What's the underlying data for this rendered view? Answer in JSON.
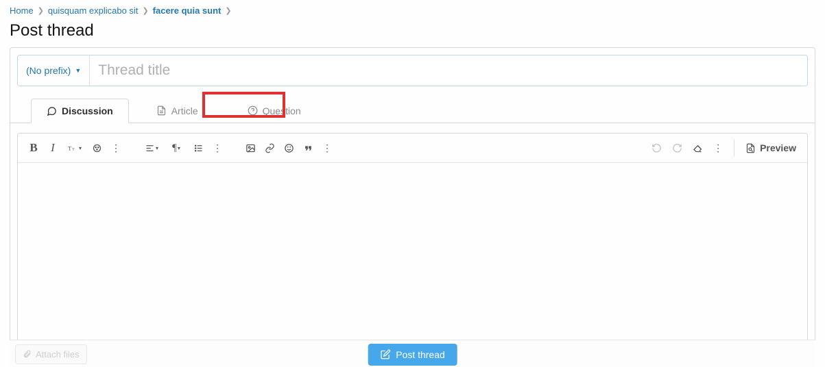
{
  "breadcrumb": {
    "home": "Home",
    "level1": "quisquam explicabo sit",
    "level2": "facere quia sunt"
  },
  "page_title": "Post thread",
  "prefix": {
    "label": "(No prefix)"
  },
  "title_field": {
    "placeholder": "Thread title"
  },
  "tabs": {
    "discussion": "Discussion",
    "article": "Article",
    "question": "Question"
  },
  "toolbar": {
    "preview": "Preview"
  },
  "footer": {
    "attach": "Attach files",
    "post": "Post thread"
  }
}
